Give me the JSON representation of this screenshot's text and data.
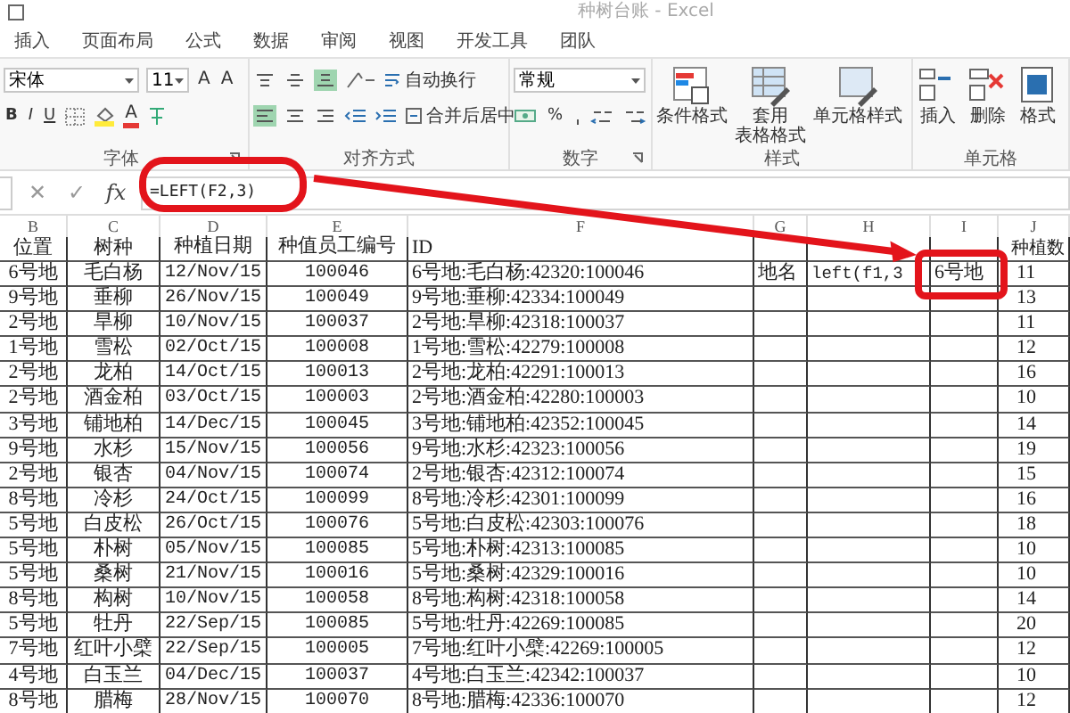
{
  "window": {
    "title": "种树台账 - Excel"
  },
  "ribbon_tabs": [
    {
      "label": "插入",
      "selected": false
    },
    {
      "label": "页面布局",
      "selected": false
    },
    {
      "label": "公式",
      "selected": false
    },
    {
      "label": "数据",
      "selected": false
    },
    {
      "label": "审阅",
      "selected": false
    },
    {
      "label": "视图",
      "selected": false
    },
    {
      "label": "开发工具",
      "selected": false
    },
    {
      "label": "团队",
      "selected": false
    }
  ],
  "font_group": {
    "font_name": "宋体",
    "font_size": "11",
    "grow_font": "A",
    "shrink_font": "A",
    "bold": "B",
    "italic": "I",
    "underline": "U",
    "font_color_letter": "A",
    "label": "字体"
  },
  "alignment_group": {
    "vertical_align": [
      {
        "kind": "top",
        "selected": false
      },
      {
        "kind": "middle",
        "selected": false
      },
      {
        "kind": "bottom",
        "selected": true
      }
    ],
    "horizontal_align": [
      {
        "kind": "left",
        "selected": true
      },
      {
        "kind": "center",
        "selected": false
      },
      {
        "kind": "right",
        "selected": false
      }
    ],
    "wrap_text": "自动换行",
    "merge_center": "合并后居中",
    "label": "对齐方式"
  },
  "number_group": {
    "format": "常规",
    "percent": "%",
    "label": "数字"
  },
  "styles_group": {
    "buttons": [
      {
        "kind": "conditional",
        "lines": [
          "条件格式"
        ]
      },
      {
        "kind": "table",
        "lines": [
          "套用",
          "表格格式"
        ]
      },
      {
        "kind": "cell",
        "lines": [
          "单元格样式"
        ]
      }
    ],
    "label": "样式"
  },
  "cells_group": {
    "buttons": [
      {
        "kind": "insert",
        "label": "插入"
      },
      {
        "kind": "delete",
        "label": "删除"
      },
      {
        "kind": "format",
        "label": "格式"
      }
    ],
    "label": "单元格"
  },
  "formula_bar": {
    "cancel": "✕",
    "enter": "✓",
    "fx": "fx",
    "formula": "=LEFT(F2,3)"
  },
  "columns": [
    "B",
    "C",
    "D",
    "E",
    "F",
    "G",
    "H",
    "I",
    "J"
  ],
  "rows": [
    {
      "B": "位置",
      "C": "树种",
      "D": "种植日期",
      "E": "种值员工编号",
      "F": "ID",
      "J": "种植数"
    },
    {
      "B": "6号地",
      "C": "毛白杨",
      "D": "12/Nov/15",
      "E": "100046",
      "F": "6号地:毛白杨:42320:100046",
      "G": "地名",
      "H": "left(f1,3",
      "I": "6号地",
      "J": "11"
    },
    {
      "B": "9号地",
      "C": "垂柳",
      "D": "26/Nov/15",
      "E": "100049",
      "F": "9号地:垂柳:42334:100049",
      "J": "13"
    },
    {
      "B": "2号地",
      "C": "旱柳",
      "D": "10/Nov/15",
      "E": "100037",
      "F": "2号地:旱柳:42318:100037",
      "J": "11"
    },
    {
      "B": "1号地",
      "C": "雪松",
      "D": "02/Oct/15",
      "E": "100008",
      "F": "1号地:雪松:42279:100008",
      "J": "12"
    },
    {
      "B": "2号地",
      "C": "龙柏",
      "D": "14/Oct/15",
      "E": "100013",
      "F": "2号地:龙柏:42291:100013",
      "J": "16"
    },
    {
      "B": "2号地",
      "C": "酒金柏",
      "D": "03/Oct/15",
      "E": "100003",
      "F": "2号地:酒金柏:42280:100003",
      "J": "10"
    },
    {
      "B": "3号地",
      "C": "铺地柏",
      "D": "14/Dec/15",
      "E": "100045",
      "F": "3号地:铺地柏:42352:100045",
      "J": "14"
    },
    {
      "B": "9号地",
      "C": "水杉",
      "D": "15/Nov/15",
      "E": "100056",
      "F": "9号地:水杉:42323:100056",
      "J": "19"
    },
    {
      "B": "2号地",
      "C": "银杏",
      "D": "04/Nov/15",
      "E": "100074",
      "F": "2号地:银杏:42312:100074",
      "J": "15"
    },
    {
      "B": "8号地",
      "C": "冷杉",
      "D": "24/Oct/15",
      "E": "100099",
      "F": "8号地:冷杉:42301:100099",
      "J": "16"
    },
    {
      "B": "5号地",
      "C": "白皮松",
      "D": "26/Oct/15",
      "E": "100076",
      "F": "5号地:白皮松:42303:100076",
      "J": "18"
    },
    {
      "B": "5号地",
      "C": "朴树",
      "D": "05/Nov/15",
      "E": "100085",
      "F": "5号地:朴树:42313:100085",
      "J": "10"
    },
    {
      "B": "5号地",
      "C": "桑树",
      "D": "21/Nov/15",
      "E": "100016",
      "F": "5号地:桑树:42329:100016",
      "J": "10"
    },
    {
      "B": "8号地",
      "C": "构树",
      "D": "10/Nov/15",
      "E": "100058",
      "F": "8号地:构树:42318:100058",
      "J": "14"
    },
    {
      "B": "5号地",
      "C": "牡丹",
      "D": "22/Sep/15",
      "E": "100085",
      "F": "5号地:牡丹:42269:100085",
      "J": "20"
    },
    {
      "B": "7号地",
      "C": "红叶小檗",
      "D": "22/Sep/15",
      "E": "100005",
      "F": "7号地:红叶小檗:42269:100005",
      "J": "12"
    },
    {
      "B": "4号地",
      "C": "白玉兰",
      "D": "04/Dec/15",
      "E": "100037",
      "F": "4号地:白玉兰:42342:100037",
      "J": "10"
    },
    {
      "B": "8号地",
      "C": "腊梅",
      "D": "28/Nov/15",
      "E": "100070",
      "F": "8号地:腊梅:42336:100070",
      "J": "12"
    }
  ]
}
